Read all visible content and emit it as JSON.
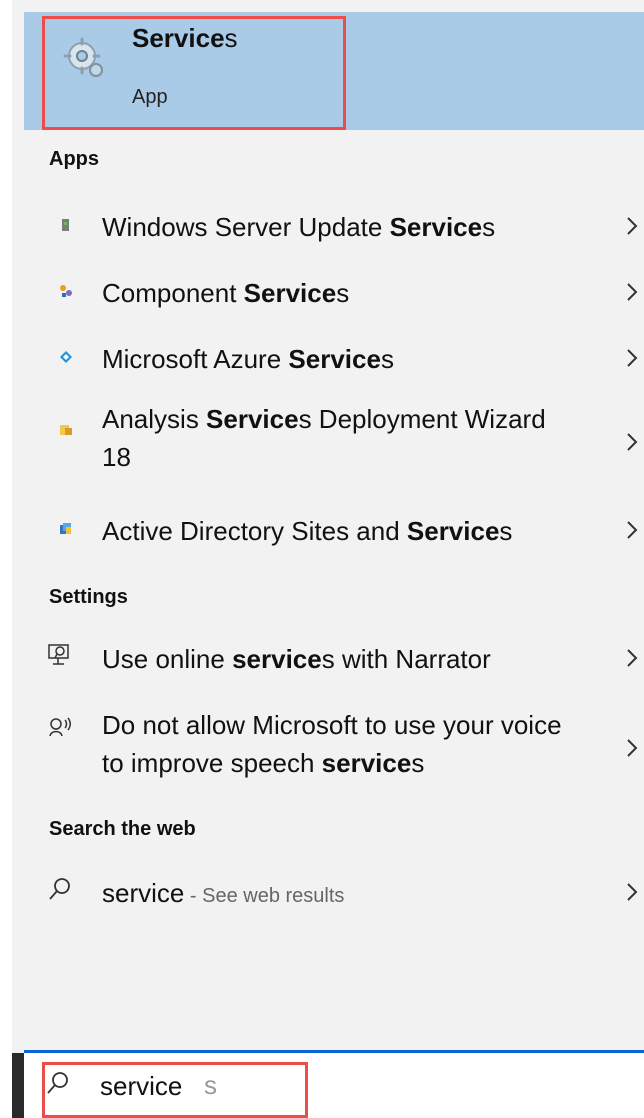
{
  "best_match": {
    "icon": "services-gear-icon",
    "title_bold": "Service",
    "title_rest": "s",
    "subtitle": "App"
  },
  "sections": {
    "apps": "Apps",
    "settings": "Settings",
    "web": "Search the web"
  },
  "apps": [
    {
      "before": "Windows Server Update ",
      "bold": "Service",
      "after": "s",
      "icon": "windows-server-update-services-icon"
    },
    {
      "before": "Component ",
      "bold": "Service",
      "after": "s",
      "icon": "component-services-icon"
    },
    {
      "before": "Microsoft Azure ",
      "bold": "Service",
      "after": "s",
      "icon": "azure-services-icon"
    },
    {
      "before": "Analysis ",
      "bold": "Service",
      "after": "s Deployment Wizard 18",
      "icon": "analysis-services-deployment-icon"
    },
    {
      "before": "Active Directory Sites and ",
      "bold": "Service",
      "after": "s",
      "icon": "active-directory-sites-services-icon"
    }
  ],
  "settings": [
    {
      "before": "Use online ",
      "bold": "service",
      "after": "s with Narrator",
      "icon": "narrator-online-services-icon"
    },
    {
      "before": "Do not allow Microsoft to use your voice to improve speech ",
      "bold": "service",
      "after": "s",
      "icon": "speech-voice-icon"
    }
  ],
  "web": {
    "query": "service",
    "suffix": " - See web results",
    "icon": "search-icon"
  },
  "search": {
    "typed": "service",
    "ghost": "s",
    "icon": "search-icon"
  },
  "colors": {
    "accent": "#0a64d6",
    "selected": "#a9cbe8",
    "panel": "#f2f2f2",
    "highlight": "#ee4b4b"
  }
}
